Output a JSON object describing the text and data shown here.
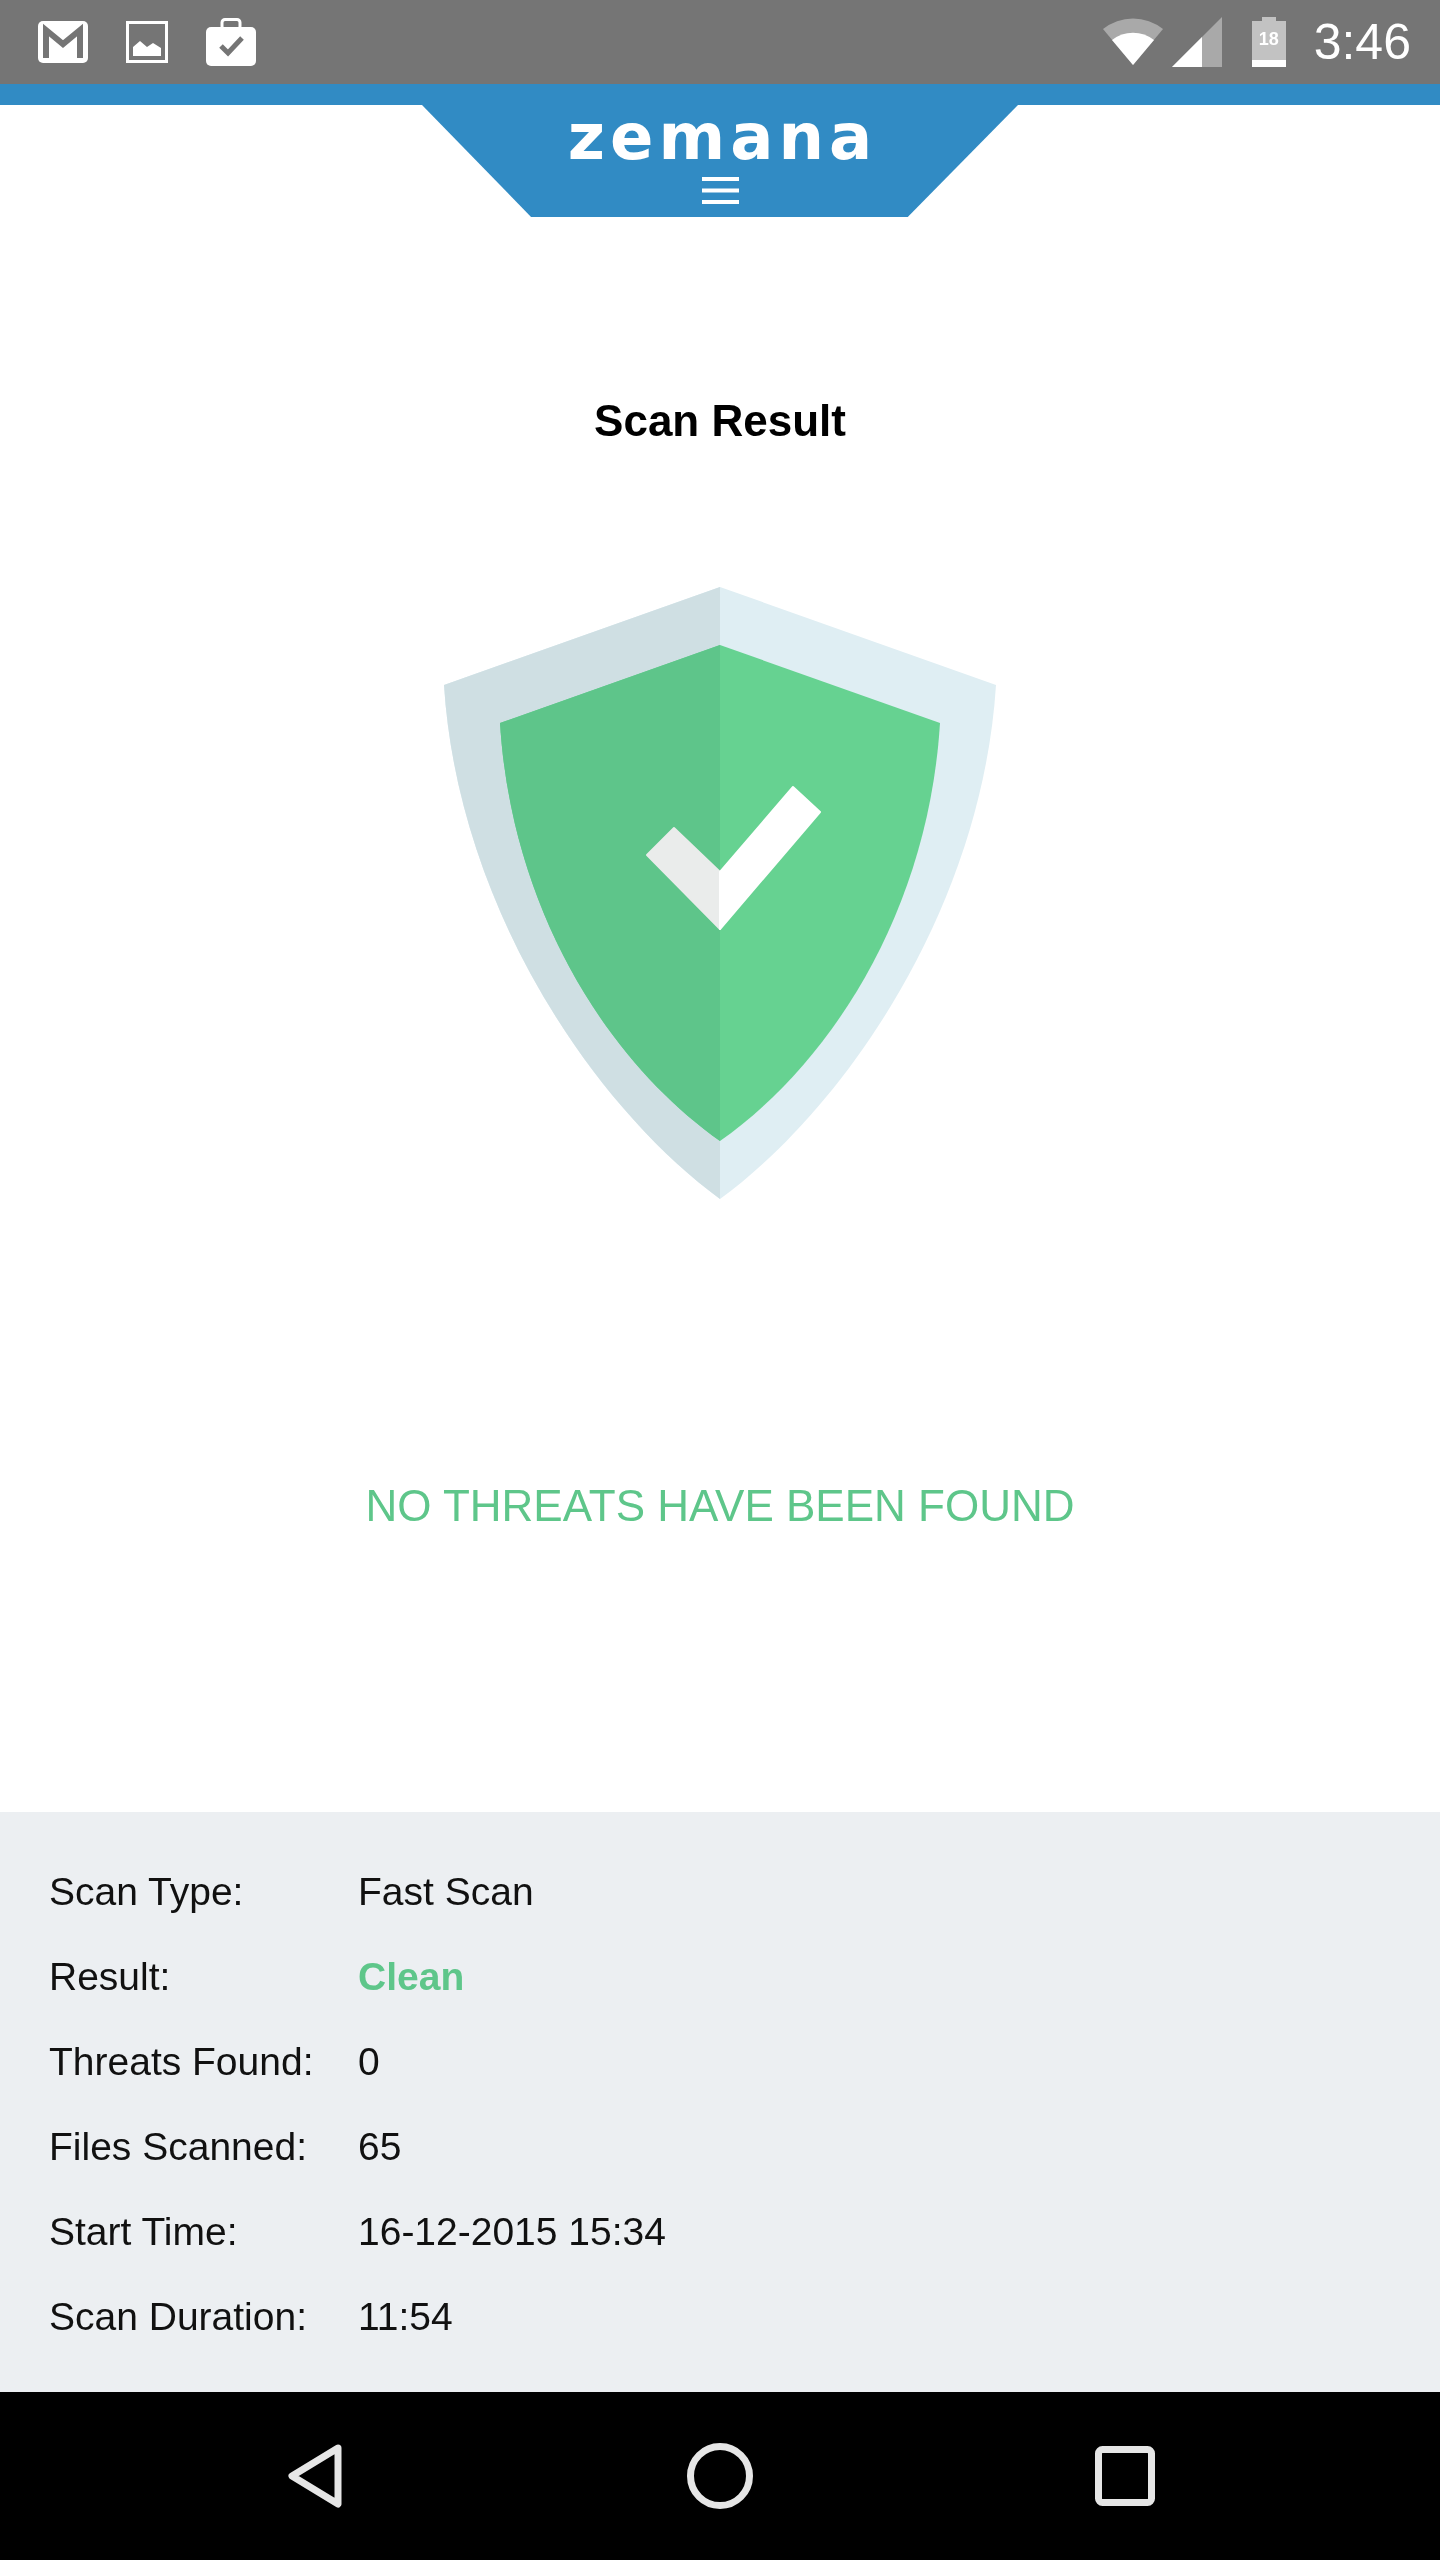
{
  "status_bar": {
    "time": "3:46",
    "battery_text": "18"
  },
  "header": {
    "logo": "zemana"
  },
  "title": "Scan Result",
  "result_message": "NO THREATS HAVE BEEN FOUND",
  "details": [
    {
      "label": "Scan Type:",
      "value": "Fast Scan",
      "kind": "text"
    },
    {
      "label": "Result:",
      "value": "Clean",
      "kind": "status"
    },
    {
      "label": "Threats Found:",
      "value": "0",
      "kind": "text"
    },
    {
      "label": "Files Scanned:",
      "value": "65",
      "kind": "text"
    },
    {
      "label": "Start Time:",
      "value": "16-12-2015 15:34",
      "kind": "text"
    },
    {
      "label": "Scan Duration:",
      "value": "11:54",
      "kind": "text"
    }
  ]
}
